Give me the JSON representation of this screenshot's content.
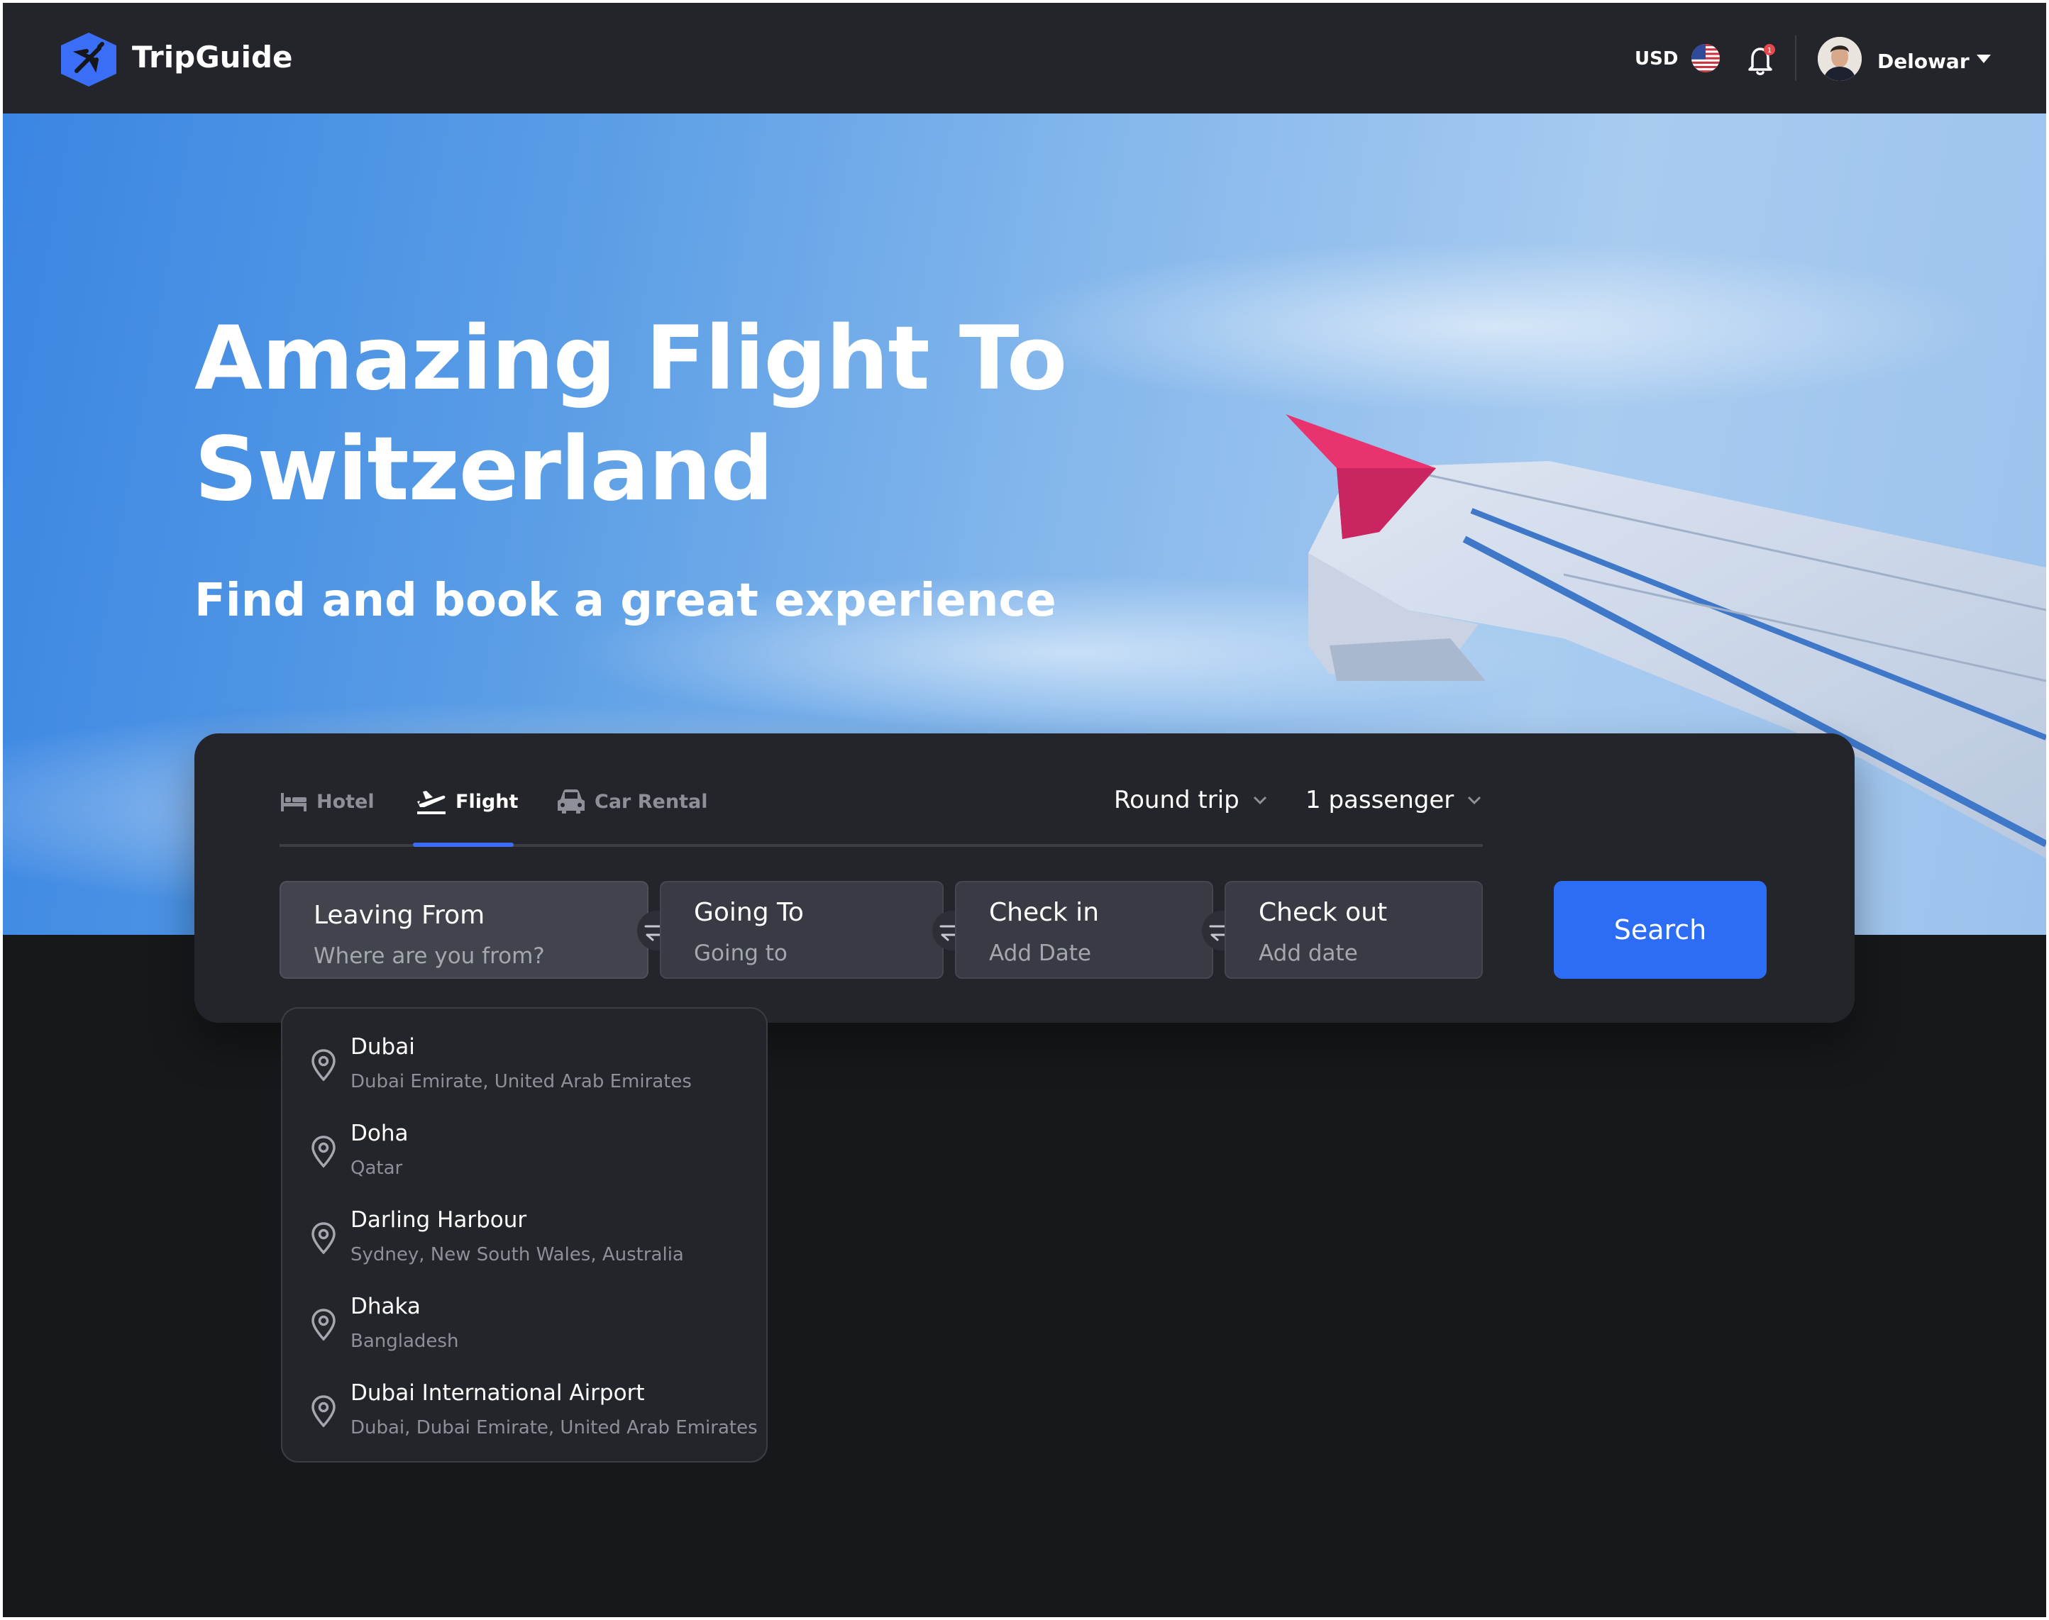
{
  "header": {
    "brand": "TripGuide",
    "currency": "USD",
    "username": "Delowar",
    "notification_count": 1
  },
  "hero": {
    "title": "Amazing Flight To Switzerland",
    "subtitle": "Find and book a great experience"
  },
  "search": {
    "tabs": [
      {
        "label": "Hotel",
        "icon": "bed-icon",
        "active": false
      },
      {
        "label": "Flight",
        "icon": "plane-takeoff-icon",
        "active": true
      },
      {
        "label": "Car Rental",
        "icon": "car-icon",
        "active": false
      }
    ],
    "trip_type": "Round trip",
    "passengers": "1 passenger",
    "fields": [
      {
        "label": "Leaving From",
        "placeholder": "Where are you from?"
      },
      {
        "label": "Going To",
        "placeholder": "Going to"
      },
      {
        "label": "Check in",
        "placeholder": "Add Date"
      },
      {
        "label": "Check out",
        "placeholder": "Add date"
      }
    ],
    "button": "Search"
  },
  "suggestions": [
    {
      "name": "Dubai",
      "region": "Dubai Emirate, United Arab Emirates"
    },
    {
      "name": "Doha",
      "region": "Qatar"
    },
    {
      "name": "Darling Harbour",
      "region": "Sydney, New South Wales, Australia"
    },
    {
      "name": "Dhaka",
      "region": "Bangladesh"
    },
    {
      "name": "Dubai International Airport",
      "region": "Dubai, Dubai Emirate, United Arab Emirates"
    }
  ],
  "colors": {
    "accent": "#2d6cf5",
    "header_bg": "#23252a",
    "page_bg": "#17181b",
    "wing_tip": "#e8336f"
  }
}
